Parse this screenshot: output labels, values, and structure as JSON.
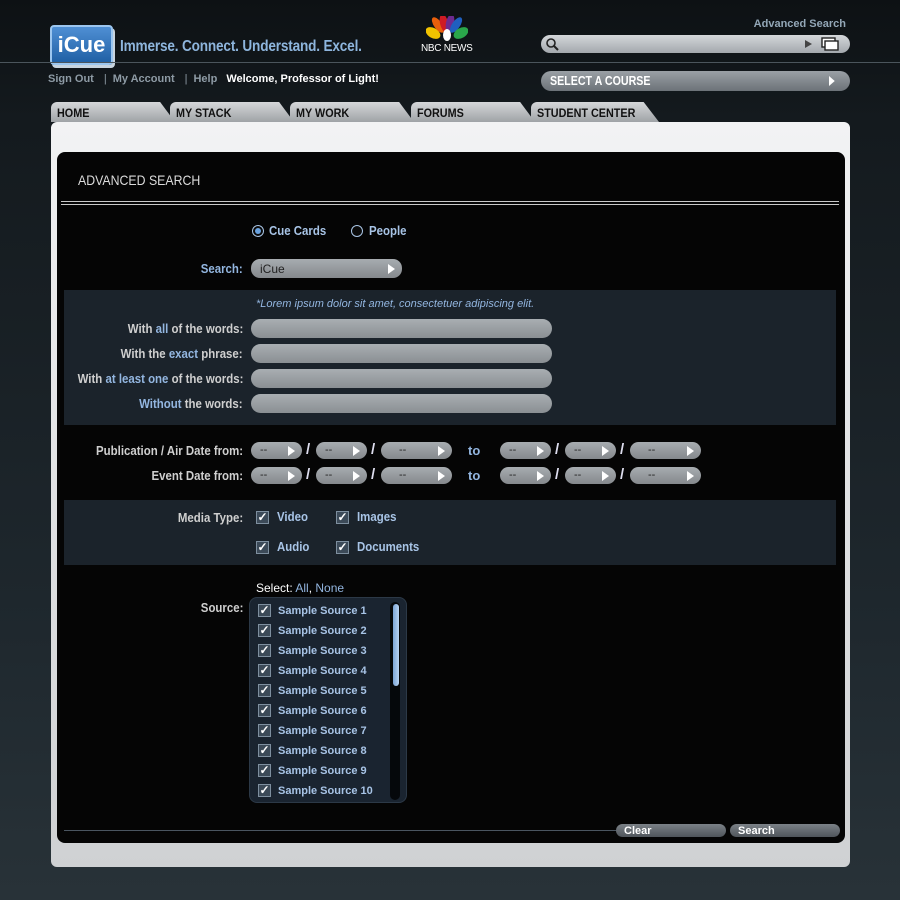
{
  "header": {
    "logo_text": "iCue",
    "tagline": "Immerse. Connect. Understand. Excel.",
    "nbc_label": "NBC NEWS",
    "advanced_search_link": "Advanced Search",
    "search_value": ""
  },
  "util_nav": {
    "sign_out": "Sign Out",
    "my_account": "My Account",
    "help": "Help",
    "separator": "|",
    "welcome": "Welcome, Professor of Light!"
  },
  "course_select": {
    "label": "SELECT A COURSE"
  },
  "tabs": [
    "HOME",
    "MY STACK",
    "MY WORK",
    "FORUMS",
    "STUDENT CENTER"
  ],
  "form": {
    "title": "ADVANCED SEARCH",
    "search_type": {
      "options": [
        "Cue Cards",
        "People"
      ],
      "selected": "Cue Cards"
    },
    "search": {
      "label": "Search:",
      "value": "iCue"
    },
    "hint": "*Lorem ipsum dolor sit amet, consectetuer adipiscing elit.",
    "word_fields": {
      "all": {
        "pre": "With ",
        "hl": "all",
        "post": " of the words:",
        "value": ""
      },
      "exact": {
        "pre": "With the ",
        "hl": "exact",
        "post": " phrase:",
        "value": ""
      },
      "atleast": {
        "pre": "With ",
        "hl": "at least one",
        "post": " of the words:",
        "value": ""
      },
      "without": {
        "pre": "",
        "hl": "Without",
        "post": " the words:",
        "value": ""
      }
    },
    "dates": {
      "pub_label": "Publication / Air Date from:",
      "event_label": "Event Date from:",
      "placeholder": "--",
      "slash": "/",
      "to": "to"
    },
    "media_type": {
      "label": "Media Type:",
      "video": {
        "label": "Video",
        "checked": true
      },
      "images": {
        "label": "Images",
        "checked": true
      },
      "audio": {
        "label": "Audio",
        "checked": true
      },
      "documents": {
        "label": "Documents",
        "checked": true
      }
    },
    "source": {
      "label": "Source:",
      "select_prefix": "Select:",
      "select_all": "All",
      "select_comma": ",",
      "select_none": "None",
      "items": [
        "Sample Source 1",
        "Sample Source 2",
        "Sample Source 3",
        "Sample Source 4",
        "Sample Source 5",
        "Sample Source 6",
        "Sample Source 7",
        "Sample Source 8",
        "Sample Source 9",
        "Sample Source 10"
      ]
    },
    "clear_label": "Clear",
    "search_button_label": "Search"
  },
  "colors": {
    "accent": "#93b6e0",
    "panel": "#050505",
    "band": "#1b232b"
  }
}
